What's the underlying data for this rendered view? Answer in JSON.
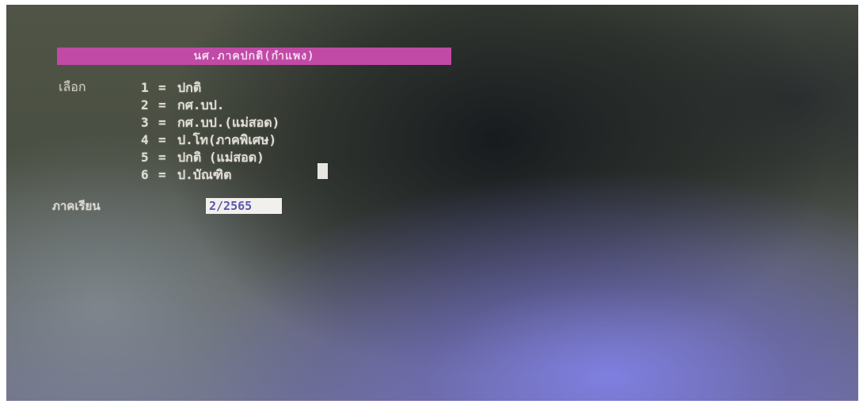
{
  "header": {
    "title": "นศ.ภาคปกติ(กำแพง)"
  },
  "menu": {
    "prompt_label": "เลือก",
    "items": [
      {
        "num": "1",
        "sep": "=",
        "label": "ปกติ"
      },
      {
        "num": "2",
        "sep": "=",
        "label": "กศ.บป."
      },
      {
        "num": "3",
        "sep": "=",
        "label": "กศ.บป.(แม่สอด)"
      },
      {
        "num": "4",
        "sep": "=",
        "label": "ป.โท(ภาคพิเศษ)"
      },
      {
        "num": "5",
        "sep": "=",
        "label": "ปกติ (แม่สอด)"
      },
      {
        "num": "6",
        "sep": "=",
        "label": "ป.บัณฑิต"
      }
    ]
  },
  "term": {
    "label": "ภาคเรียน",
    "value": "2/2565"
  },
  "colors": {
    "title_bar": "#c04aa6",
    "text": "#dedad2",
    "input_bg": "#f2f0ec",
    "input_text": "#5a5ab0"
  }
}
